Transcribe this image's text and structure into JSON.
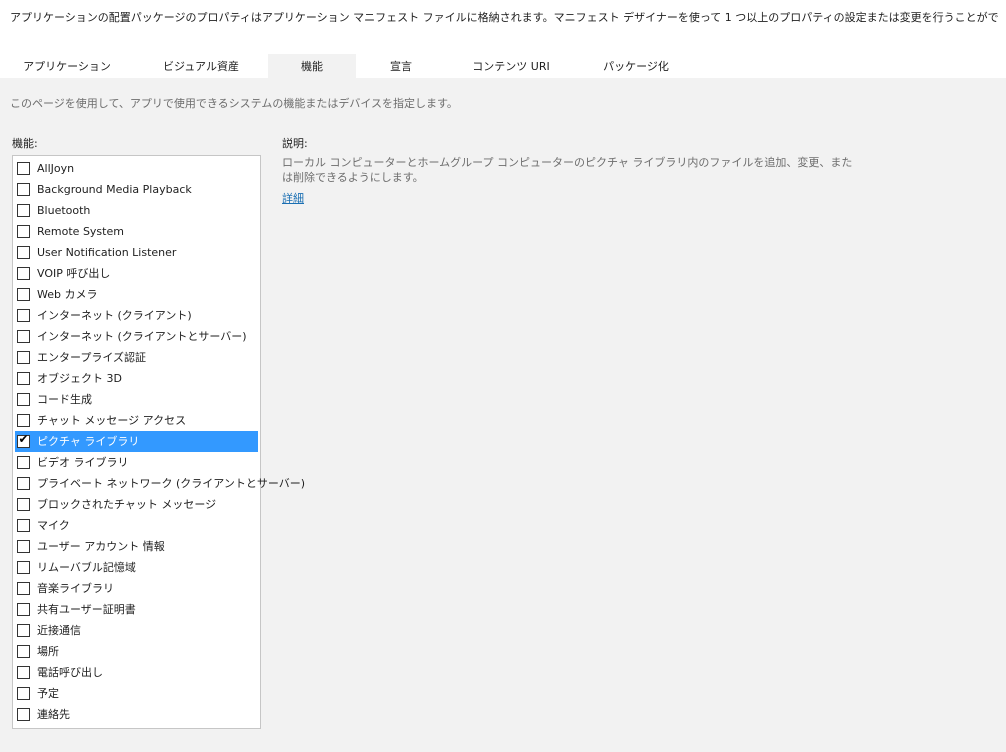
{
  "header": {
    "description": "アプリケーションの配置パッケージのプロパティはアプリケーション マニフェスト ファイルに格納されます。マニフェスト デザイナーを使って 1 つ以上のプロパティの設定または変更を行うことができます。"
  },
  "tabs": [
    {
      "label": "アプリケーション",
      "active": false
    },
    {
      "label": "ビジュアル資産",
      "active": false
    },
    {
      "label": "機能",
      "active": true
    },
    {
      "label": "宣言",
      "active": false
    },
    {
      "label": "コンテンツ URI",
      "active": false
    },
    {
      "label": "パッケージ化",
      "active": false
    }
  ],
  "page": {
    "description": "このページを使用して、アプリで使用できるシステムの機能またはデバイスを指定します。"
  },
  "capabilities": {
    "header": "機能:",
    "items": [
      {
        "label": "AllJoyn",
        "checked": false,
        "selected": false
      },
      {
        "label": "Background Media Playback",
        "checked": false,
        "selected": false
      },
      {
        "label": "Bluetooth",
        "checked": false,
        "selected": false
      },
      {
        "label": "Remote System",
        "checked": false,
        "selected": false
      },
      {
        "label": "User Notification Listener",
        "checked": false,
        "selected": false
      },
      {
        "label": "VOIP 呼び出し",
        "checked": false,
        "selected": false
      },
      {
        "label": "Web カメラ",
        "checked": false,
        "selected": false
      },
      {
        "label": "インターネット (クライアント)",
        "checked": false,
        "selected": false
      },
      {
        "label": "インターネット (クライアントとサーバー)",
        "checked": false,
        "selected": false
      },
      {
        "label": "エンタープライズ認証",
        "checked": false,
        "selected": false
      },
      {
        "label": "オブジェクト 3D",
        "checked": false,
        "selected": false
      },
      {
        "label": "コード生成",
        "checked": false,
        "selected": false
      },
      {
        "label": "チャット メッセージ アクセス",
        "checked": false,
        "selected": false
      },
      {
        "label": "ピクチャ ライブラリ",
        "checked": true,
        "selected": true
      },
      {
        "label": "ビデオ ライブラリ",
        "checked": false,
        "selected": false
      },
      {
        "label": "プライベート ネットワーク (クライアントとサーバー)",
        "checked": false,
        "selected": false
      },
      {
        "label": "ブロックされたチャット メッセージ",
        "checked": false,
        "selected": false
      },
      {
        "label": "マイク",
        "checked": false,
        "selected": false
      },
      {
        "label": "ユーザー アカウント 情報",
        "checked": false,
        "selected": false
      },
      {
        "label": "リムーバブル記憶域",
        "checked": false,
        "selected": false
      },
      {
        "label": "音楽ライブラリ",
        "checked": false,
        "selected": false
      },
      {
        "label": "共有ユーザー証明書",
        "checked": false,
        "selected": false
      },
      {
        "label": "近接通信",
        "checked": false,
        "selected": false
      },
      {
        "label": "場所",
        "checked": false,
        "selected": false
      },
      {
        "label": "電話呼び出し",
        "checked": false,
        "selected": false
      },
      {
        "label": "予定",
        "checked": false,
        "selected": false
      },
      {
        "label": "連絡先",
        "checked": false,
        "selected": false
      }
    ]
  },
  "description_panel": {
    "header": "説明:",
    "text": "ローカル コンピューターとホームグループ コンピューターのピクチャ ライブラリ内のファイルを追加、変更、または削除できるようにします。",
    "link": "詳細"
  },
  "colors": {
    "selection": "#3399ff",
    "link": "#1a6fb3",
    "panel_background": "#f2f2f2"
  }
}
